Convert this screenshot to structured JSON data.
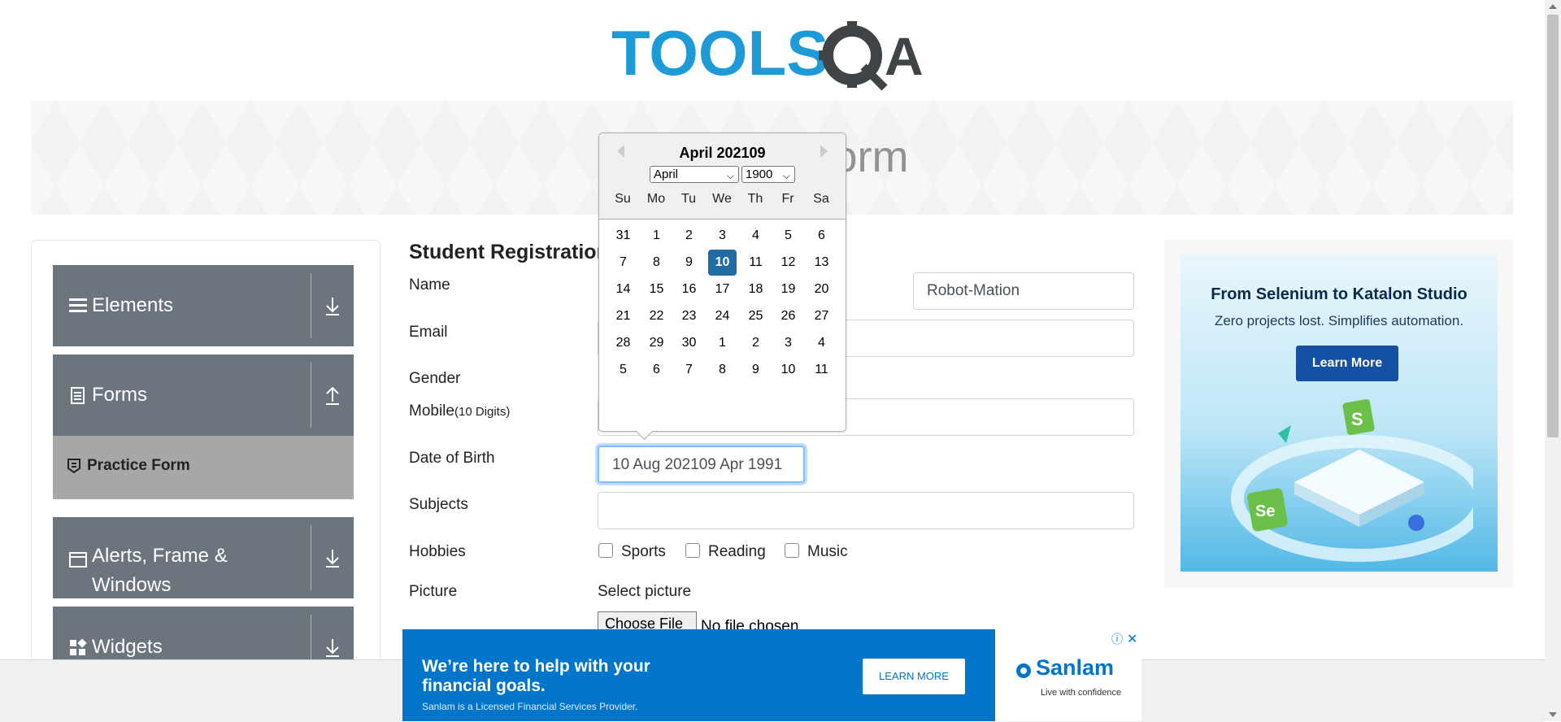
{
  "logo": {
    "text": "TOOLSQA"
  },
  "banner": {
    "title": "Practice Form"
  },
  "sidebar": {
    "groups": [
      {
        "label": "Elements",
        "icon": "menu-icon",
        "arrow": "arrow-down-icon"
      },
      {
        "label": "Forms",
        "icon": "form-icon",
        "arrow": "arrow-up-icon"
      },
      {
        "label": "Alerts, Frame & Windows",
        "icon": "window-icon",
        "arrow": "arrow-down-icon"
      },
      {
        "label": "Widgets",
        "icon": "widgets-icon",
        "arrow": "arrow-down-icon"
      }
    ],
    "active_item": "Practice Form"
  },
  "form": {
    "title": "Student Registration",
    "labels": {
      "name": "Name",
      "email": "Email",
      "gender": "Gender",
      "mobile": "Mobile",
      "mobile_hint": "(10 Digits)",
      "dob": "Date of Birth",
      "subjects": "Subjects",
      "hobbies": "Hobbies",
      "picture": "Picture"
    },
    "last_name_value": "Robot-Mation",
    "dob_value": "10 Aug 202109 Apr 1991",
    "hobbies": [
      "Sports",
      "Reading",
      "Music"
    ],
    "picture_select": "Select picture",
    "choose_file": "Choose File",
    "no_file": "No file chosen"
  },
  "calendar": {
    "title": "April 202109",
    "month_select": "April",
    "year_select": "1900",
    "weekdays": [
      "Su",
      "Mo",
      "Tu",
      "We",
      "Th",
      "Fr",
      "Sa"
    ],
    "weeks": [
      [
        "31",
        "1",
        "2",
        "3",
        "4",
        "5",
        "6"
      ],
      [
        "7",
        "8",
        "9",
        "10",
        "11",
        "12",
        "13"
      ],
      [
        "14",
        "15",
        "16",
        "17",
        "18",
        "19",
        "20"
      ],
      [
        "21",
        "22",
        "23",
        "24",
        "25",
        "26",
        "27"
      ],
      [
        "28",
        "29",
        "30",
        "1",
        "2",
        "3",
        "4"
      ],
      [
        "5",
        "6",
        "7",
        "8",
        "9",
        "10",
        "11"
      ]
    ],
    "selected_day": "10"
  },
  "ad_right": {
    "title": "From Selenium to Katalon Studio",
    "subtitle": "Zero projects lost. Simplifies automation.",
    "button": "Learn More"
  },
  "ad_bottom": {
    "headline": "We’re here to help with your financial goals.",
    "disclaimer": "Sanlam is a Licensed Financial Services Provider.",
    "button": "LEARN MORE",
    "brand": "Sanlam",
    "tagline": "Live with confidence"
  },
  "colors": {
    "accent": "#216ba5",
    "sidebar": "#6c757d",
    "ad_blue": "#0075c9"
  }
}
